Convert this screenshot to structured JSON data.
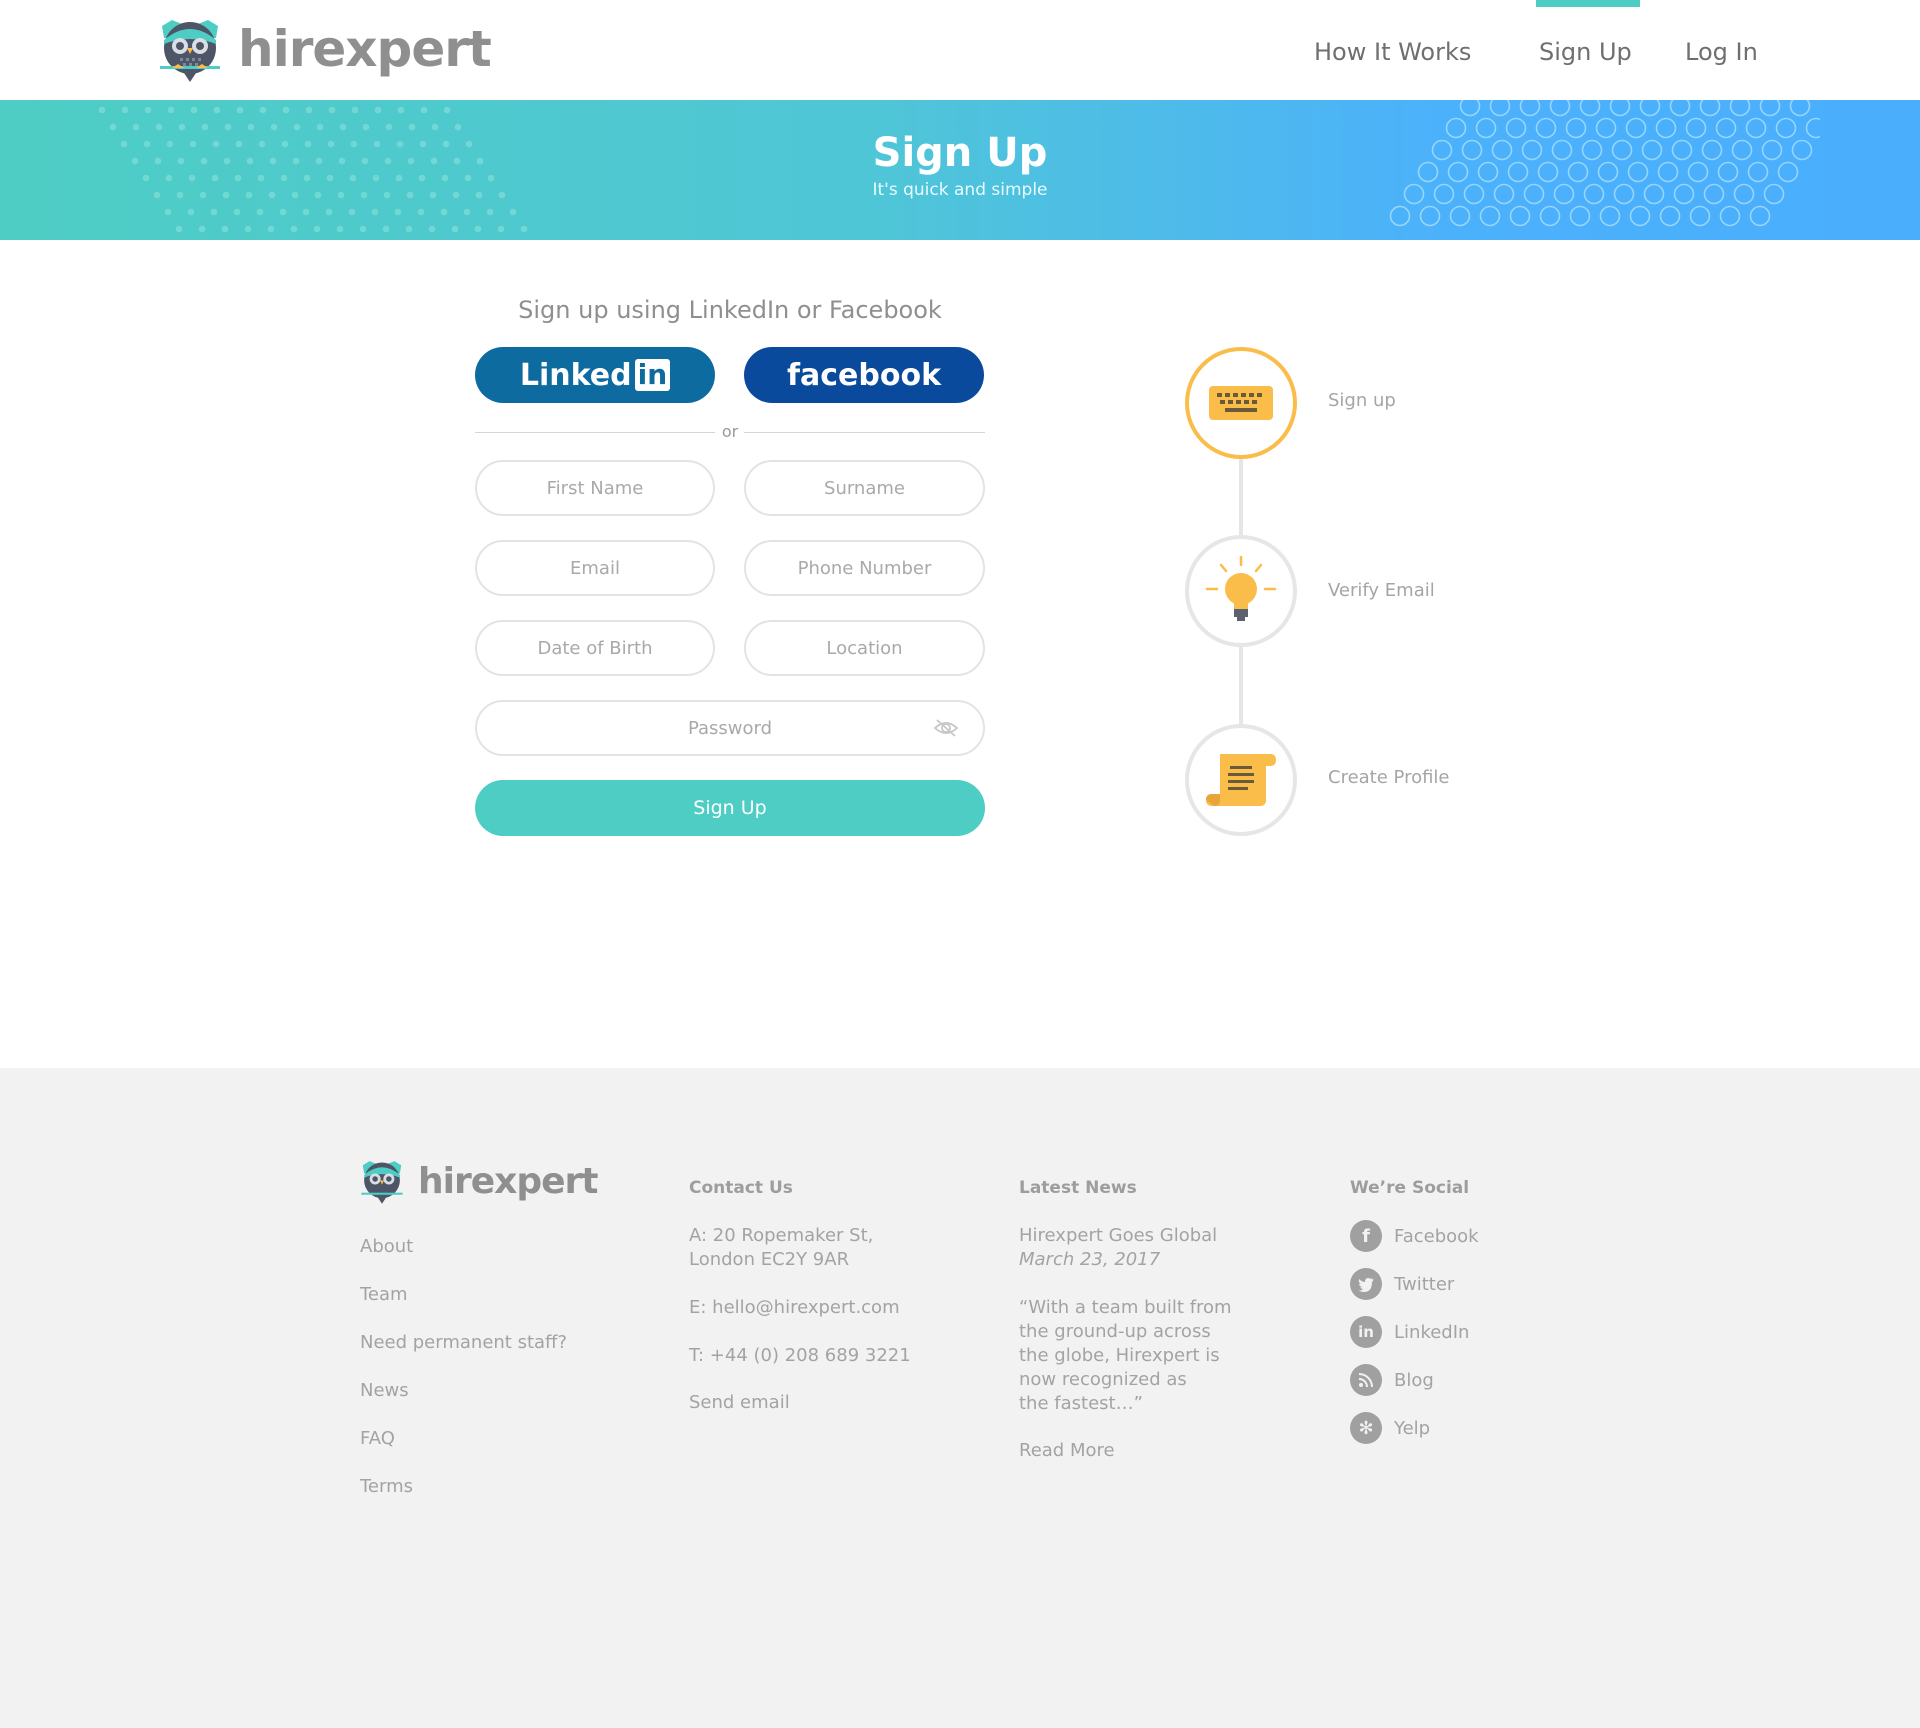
{
  "header": {
    "brand": "hirexpert",
    "nav": [
      {
        "label": "How It Works",
        "active": false
      },
      {
        "label": "Sign Up",
        "active": true
      },
      {
        "label": "Log In",
        "active": false
      }
    ]
  },
  "hero": {
    "title": "Sign Up",
    "subtitle": "It's quick and simple"
  },
  "form": {
    "heading": "Sign up using LinkedIn or Facebook",
    "linkedin_label": "Linked",
    "linkedin_box": "in",
    "facebook_label": "facebook",
    "or_text": "or",
    "fields": {
      "first_name": "First Name",
      "surname": "Surname",
      "email": "Email",
      "phone": "Phone Number",
      "dob": "Date of Birth",
      "location": "Location",
      "password": "Password"
    },
    "submit_label": "Sign Up"
  },
  "steps": [
    {
      "label": "Sign up",
      "icon": "keyboard-icon",
      "active": true
    },
    {
      "label": "Verify Email",
      "icon": "lightbulb-icon",
      "active": false
    },
    {
      "label": "Create Profile",
      "icon": "scroll-icon",
      "active": false
    }
  ],
  "footer": {
    "brand": "hirexpert",
    "links": [
      "About",
      "Team",
      "Need permanent staff?",
      "News",
      "FAQ",
      "Terms"
    ],
    "contact": {
      "heading": "Contact Us",
      "address_line1": "A: 20 Ropemaker St,",
      "address_line2": "London EC2Y 9AR",
      "email": "E: hello@hirexpert.com",
      "phone": "T: +44 (0) 208 689 3221",
      "send": "Send email"
    },
    "news": {
      "heading": "Latest News",
      "title": "Hirexpert Goes Global",
      "date": "March 23, 2017",
      "excerpt_lines": [
        "“With a team built from",
        "the ground-up across",
        "the globe, Hirexpert is",
        "now recognized as",
        "the fastest…”"
      ],
      "read_more": "Read More"
    },
    "social": {
      "heading": "We’re Social",
      "items": [
        {
          "label": "Facebook",
          "icon": "facebook-icon",
          "glyph": "f"
        },
        {
          "label": "Twitter",
          "icon": "twitter-icon",
          "glyph": ""
        },
        {
          "label": "LinkedIn",
          "icon": "linkedin-icon",
          "glyph": "in"
        },
        {
          "label": "Blog",
          "icon": "rss-icon",
          "glyph": ""
        },
        {
          "label": "Yelp",
          "icon": "yelp-icon",
          "glyph": "✻"
        }
      ]
    }
  },
  "colors": {
    "teal": "#4ecdc4",
    "blue": "#4aaefd",
    "linkedin": "#0e6ba0",
    "facebook": "#0a4a9c",
    "step_active": "#fbbd4a"
  }
}
